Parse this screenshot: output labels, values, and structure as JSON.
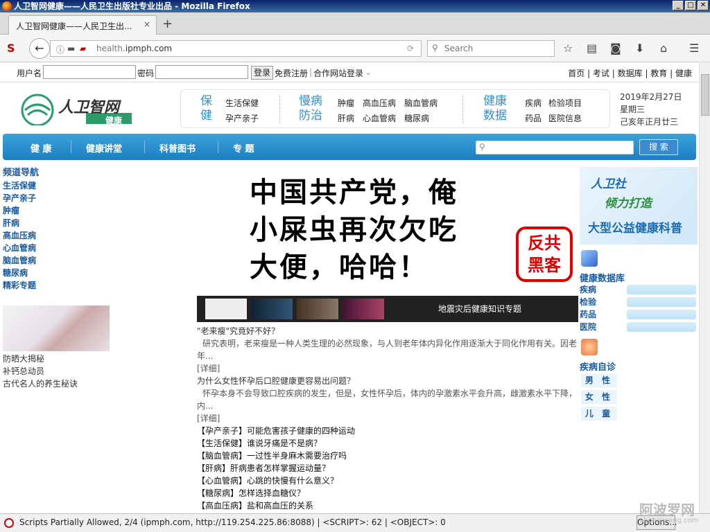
{
  "window": {
    "title": "人卫智网健康——人民卫生出版社专业出品 - Mozilla Firefox",
    "btn_min": "_",
    "btn_max": "□",
    "btn_close": "✕"
  },
  "tab": {
    "title": "人卫智网健康——人民卫生出...",
    "close": "×",
    "new_tab": "+"
  },
  "nav": {
    "url_prefix": "health.",
    "url_domain": "ipmph.com",
    "search_placeholder": "Search",
    "back": "←",
    "reload": "⟳"
  },
  "login": {
    "username_label": "用户名",
    "password_label": "密码",
    "login_btn": "登录",
    "register": "免费注册",
    "partner": "合作网站登录"
  },
  "top_links": [
    "首页",
    "考试",
    "数据库",
    "教育",
    "健康"
  ],
  "logo": {
    "name": "人卫智网",
    "sub": "健康"
  },
  "categories": {
    "baojian": {
      "head1": "保",
      "head2": "健",
      "links": [
        "生活保健",
        "孕产亲子"
      ]
    },
    "manbing": {
      "head1": "慢病",
      "head2": "防治",
      "links": [
        "肿瘤",
        "高血压病",
        "脑血管病",
        "肝病",
        "心血管病",
        "糖尿病"
      ]
    },
    "shuju": {
      "head1": "健康",
      "head2": "数据",
      "links": [
        "疾病",
        "检验项目",
        "药品",
        "医院信息"
      ]
    }
  },
  "date": {
    "line1": "2019年2月27日",
    "line2": "星期三",
    "line3": "己亥年正月廿三"
  },
  "main_nav": [
    "健 康",
    "健康讲堂",
    "科普图书",
    "专 题"
  ],
  "search_btn": "搜 索",
  "left_nav": {
    "head": "频道导航",
    "items": [
      "生活保健",
      "孕产亲子",
      "肿瘤",
      "肝病",
      "高血压病",
      "心血管病",
      "脑血管病",
      "糖尿病",
      "精彩专题"
    ]
  },
  "left_stories": [
    "防晒大揭秘",
    "补钙总动员",
    "古代名人的养生秘诀"
  ],
  "banner": {
    "line1": "中国共产党，俺",
    "line2": "小屎虫再次欠吃",
    "line3": "大便，哈哈！",
    "stamp": "反共\n黑客"
  },
  "thumb_caption": "地震灾后健康知识专题",
  "articles": [
    {
      "title": "\"老来瘦\"究竟好不好？",
      "body": "研究表明，老来瘦是一种人类生理的必然现象，与人到老年体内异化作用逐渐大于同化作用有关。因老年...",
      "more": "[详细]"
    },
    {
      "title": "为什么女性怀孕后口腔健康更容易出问题？",
      "body": "怀孕本身不会导致口腔疾病的发生，但是，女性怀孕后，体内的孕激素水平会升高，雌激素水平下降，内...",
      "more": "[详细]"
    }
  ],
  "article_links": [
    "【孕产亲子】可能危害孩子健康的四种运动",
    "【生活保健】谁说牙痛是不是病？",
    "【脑血管病】一过性半身麻木需要治疗吗",
    "【肝病】肝病患者怎样掌握运动量？",
    "【心血管病】心跳的快慢有什么意义？",
    "【糖尿病】怎样选择血糖仪？",
    "【高血压病】盐和高血压的关系"
  ],
  "right_ad": {
    "t1": "人卫社",
    "t2": "倾力打造",
    "t3": "大型公益健康科普"
  },
  "right_db": {
    "head": "健康数据库",
    "links": [
      "疾病",
      "检验",
      "药品",
      "医院"
    ]
  },
  "right_diag": {
    "head": "疾病自诊",
    "btns": [
      "男 性",
      "女 性",
      "儿 童"
    ]
  },
  "status": {
    "text": "Scripts Partially Allowed, 2/4 (ipmph.com, http://119.254.225.86:8088) | <SCRIPT>: 62 | <OBJECT>: 0",
    "options": "Options..."
  },
  "watermark": {
    "big": "阿波罗网",
    "small": "aboluowang.com"
  },
  "colors": {
    "brand_blue": "#1d7fc1",
    "brand_green": "#2a9d6a",
    "stamp_red": "#dd0000"
  }
}
